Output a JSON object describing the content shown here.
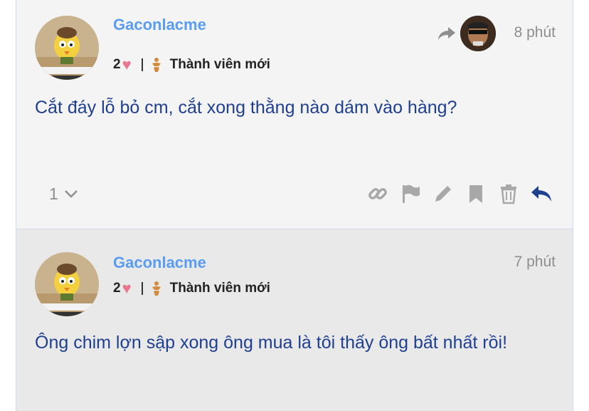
{
  "posts": [
    {
      "username": "Gaconlacme",
      "likes": "2",
      "rank": "Thành viên mới",
      "time": "8 phút",
      "content": "Cắt đáy lỗ bỏ cm, cắt xong thằng nào dám vào hàng?",
      "reply_count": "1",
      "actions": [
        "link-icon",
        "flag-icon",
        "pencil-icon",
        "bookmark-icon",
        "trash-icon",
        "reply-icon"
      ]
    },
    {
      "username": "Gaconlacme",
      "likes": "2",
      "rank": "Thành viên mới",
      "time": "7 phút",
      "content": "Ông chim lợn sập xong ông mua là tôi thấy ông bất nhất rồi!"
    }
  ],
  "colors": {
    "username": "#5a9cf0",
    "content": "#1f3f8f",
    "heart": "#e8768f",
    "rank_icon": "#d38a3b",
    "muted": "#8e8e8e",
    "action_icon": "#a8a8a8",
    "reply_icon": "#1f3f8f"
  }
}
